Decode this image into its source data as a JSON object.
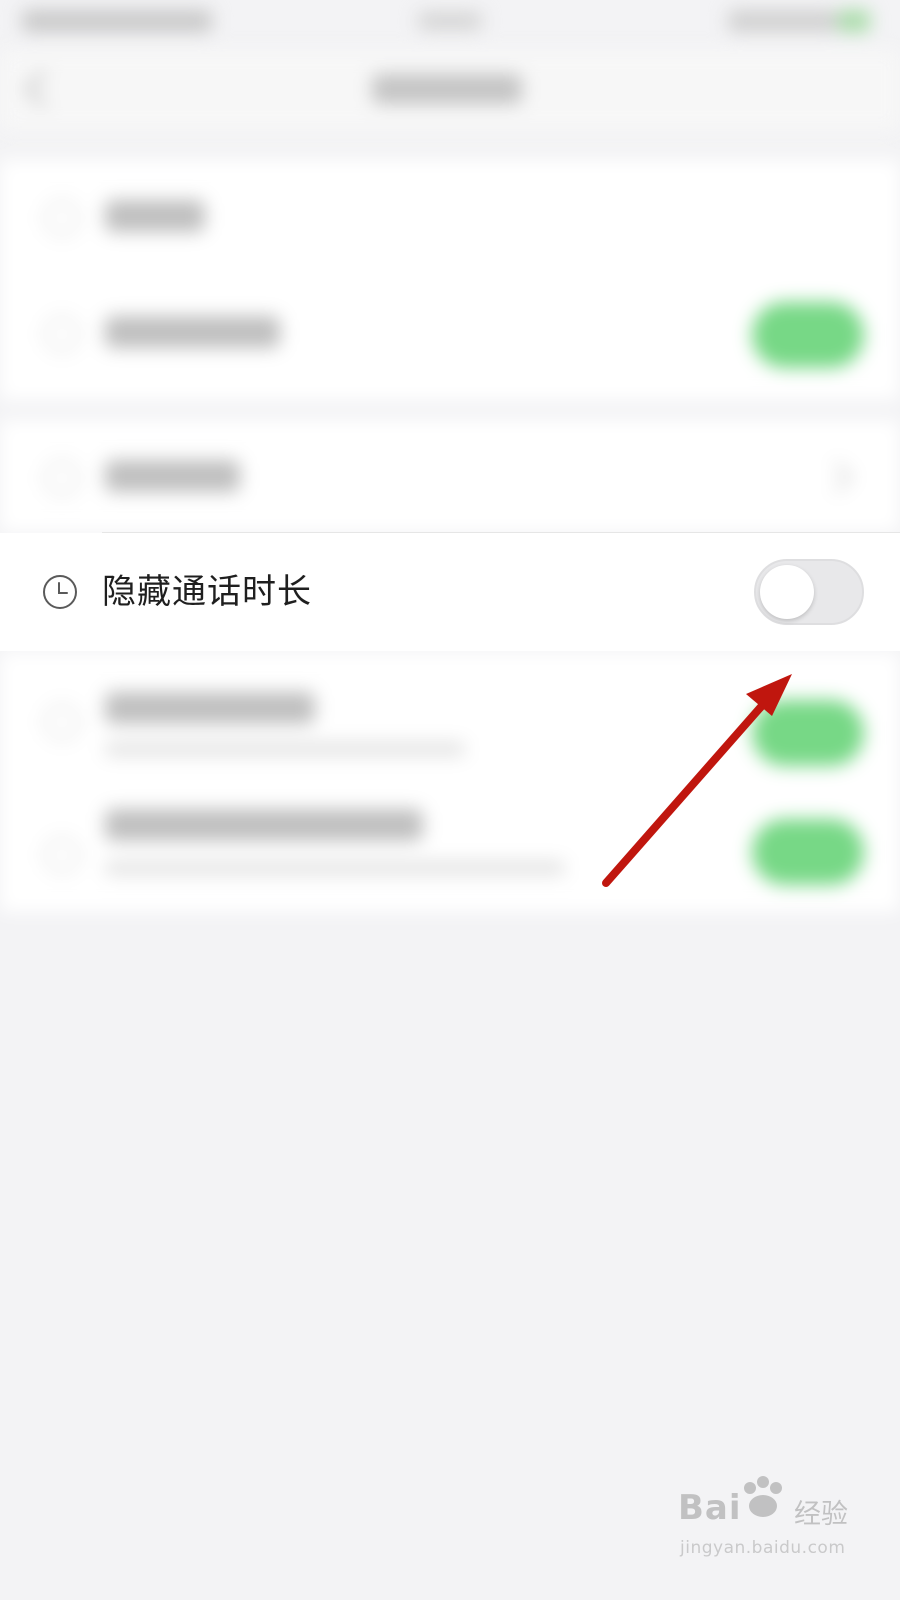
{
  "setting_row": {
    "label": "隐藏通话时长",
    "icon": "clock-icon",
    "toggle_state": "off"
  },
  "watermark": {
    "brand": "Bai",
    "brand_cn": "经验",
    "url": "jingyan.baidu.com"
  },
  "colors": {
    "background": "#f3f3f5",
    "toggle_on": "#77d886",
    "toggle_off": "#e8e8ea",
    "arrow": "#c0160e"
  }
}
